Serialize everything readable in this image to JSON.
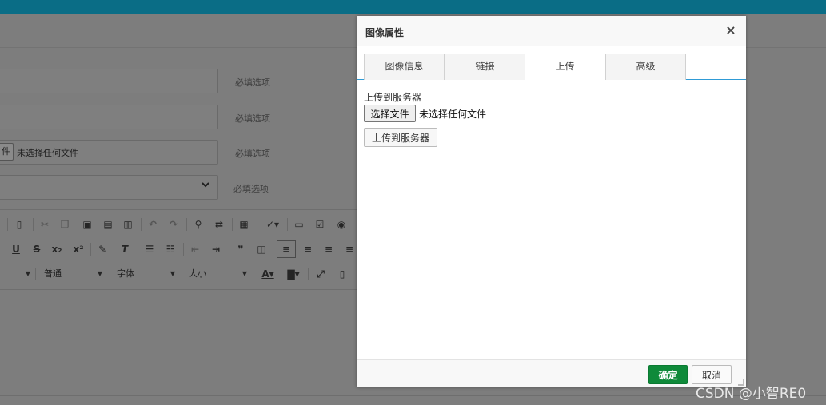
{
  "background": {
    "hints": [
      "必填选项",
      "必填选项",
      "必填选项",
      "必填选项"
    ],
    "file_button_fragment": "件",
    "file_status": "未选择任何文件",
    "toolbar": {
      "combos": [
        "普通",
        "字体",
        "大小"
      ]
    }
  },
  "dialog": {
    "title": "图像属性",
    "close_symbol": "×",
    "tabs": [
      {
        "label": "图像信息"
      },
      {
        "label": "链接"
      },
      {
        "label": "上传"
      },
      {
        "label": "高级"
      }
    ],
    "active_tab": "上传",
    "upload": {
      "label": "上传到服务器",
      "choose_file": "选择文件",
      "no_file": "未选择任何文件",
      "upload_button": "上传到服务器"
    },
    "footer": {
      "ok": "确定",
      "cancel": "取消"
    }
  },
  "watermark": "CSDN @小智RE0",
  "colors": {
    "topbar": "#0a6d86",
    "tab_active_border": "#2f9bd6",
    "ok_button": "#0f8a3a"
  }
}
